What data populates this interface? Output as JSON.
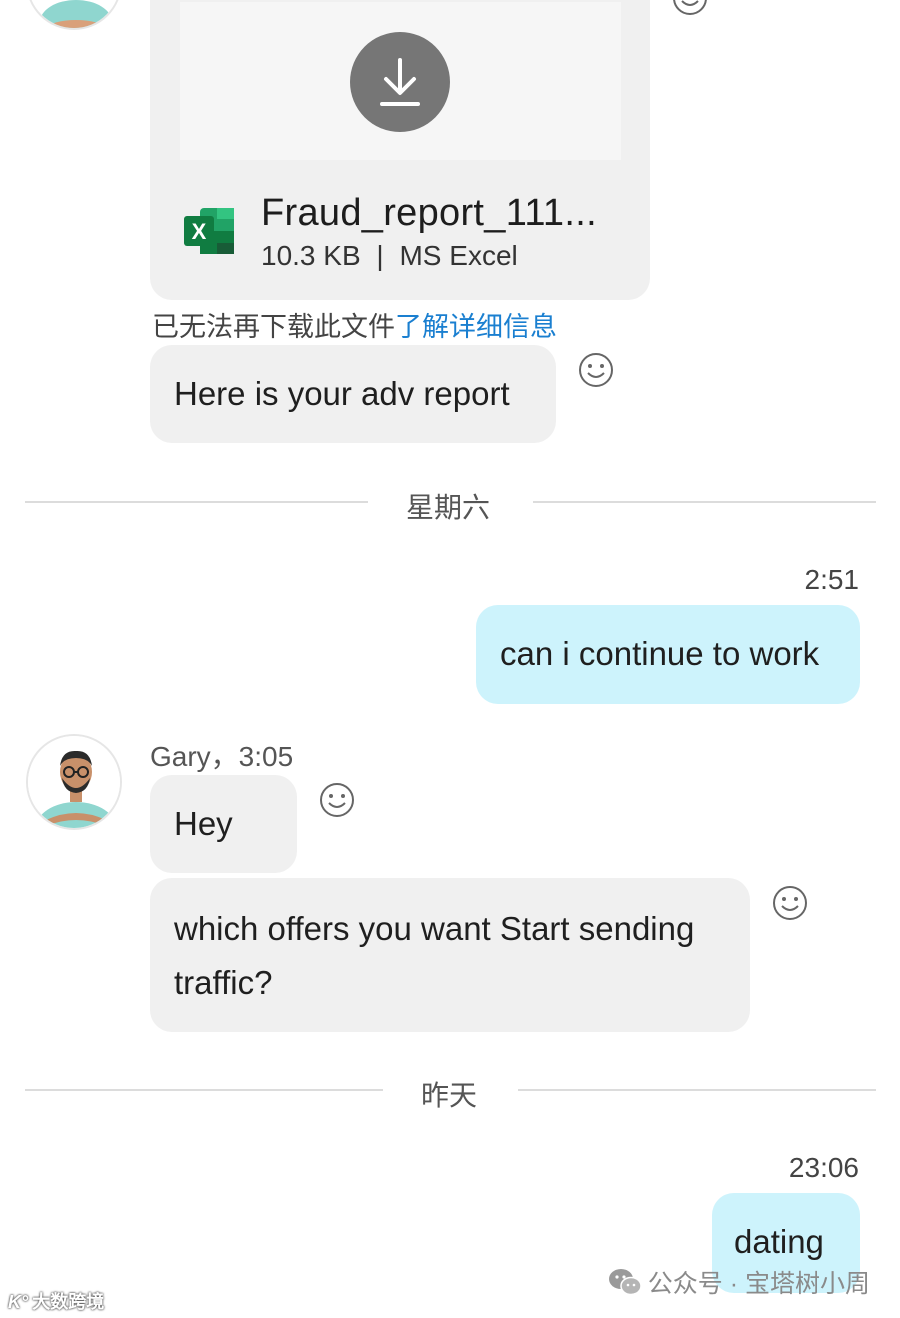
{
  "file_message": {
    "file_name": "Fraud_report_111...",
    "file_size": "10.3 KB",
    "separator": "|",
    "file_type": "MS Excel",
    "icon": "excel-icon",
    "download_icon": "download-icon"
  },
  "notice": {
    "text": "已无法再下载此文件",
    "link": "了解详细信息"
  },
  "messages": {
    "adv_report": "Here is your adv report",
    "continue_work": "can i continue to work",
    "continue_time": "2:51",
    "sender": "Gary，3:05",
    "hey": "Hey",
    "offers_line1": "which offers you want Start sending",
    "offers_line2": "traffic?",
    "dating": "dating",
    "dating_time": "23:06"
  },
  "separators": {
    "saturday": "星期六",
    "yesterday": "昨天"
  },
  "watermarks": {
    "right": "公众号 · 宝塔树小周",
    "left": "大数跨境"
  },
  "colors": {
    "incoming_bubble": "#f0f0f0",
    "outgoing_bubble": "#cdf3fc",
    "link": "#1a7fd0"
  }
}
